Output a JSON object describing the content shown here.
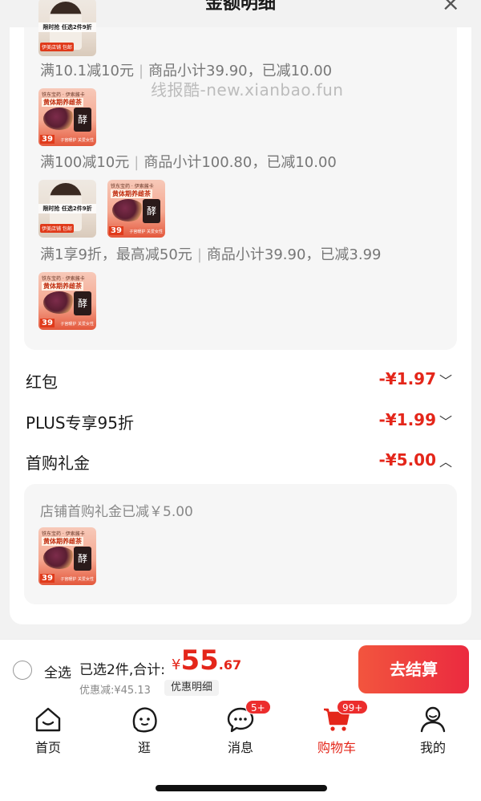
{
  "sheet": {
    "title": "金额明细",
    "close": "×"
  },
  "watermark": "线报酷-new.xianbao.fun",
  "promotions": [
    {
      "rule": "满10.1减10元",
      "detail": "商品小计39.90，已减10.00"
    },
    {
      "rule": "满100减10元",
      "detail": "商品小计100.80，已减10.00"
    },
    {
      "rule": "满1享9折，最高减50元",
      "detail": "商品小计39.90，已减3.99"
    }
  ],
  "product_thumb": {
    "top": "铁东宝药 · 伊索酱卡",
    "title": "黄体期养雌茶",
    "jar": "酵",
    "price": "39",
    "foot": "子宫暖护 关爱女性"
  },
  "product_thumb_alt": {
    "banner": "限时抢 任选2件9折",
    "badge": "伊美店铺 包邮"
  },
  "rows": [
    {
      "label": "红包",
      "amount": "-¥1.97",
      "chevron": "﹀"
    },
    {
      "label": "PLUS专享95折",
      "amount": "-¥1.99",
      "chevron": "﹀"
    },
    {
      "label": "首购礼金",
      "amount": "-¥5.00",
      "chevron": "︿"
    }
  ],
  "first_purchase": {
    "note": "店铺首购礼金已减￥5.00"
  },
  "bottom_bar": {
    "select_all": "全选",
    "selected": "已选2件,合计:",
    "currency": "¥",
    "total_int": "55",
    "total_dec": ".67",
    "discount": "优惠减:¥45.13",
    "detail_button": "优惠明细",
    "checkout": "去结算"
  },
  "tabs": [
    {
      "label": "首页",
      "icon": "home-icon"
    },
    {
      "label": "逛",
      "icon": "browse-icon"
    },
    {
      "label": "消息",
      "icon": "message-icon",
      "badge": "5+"
    },
    {
      "label": "购物车",
      "icon": "cart-icon",
      "badge": "99+",
      "active": true
    },
    {
      "label": "我的",
      "icon": "profile-icon"
    }
  ],
  "colors": {
    "accent": "#e4261a",
    "checkout": "#eb2a3f"
  }
}
